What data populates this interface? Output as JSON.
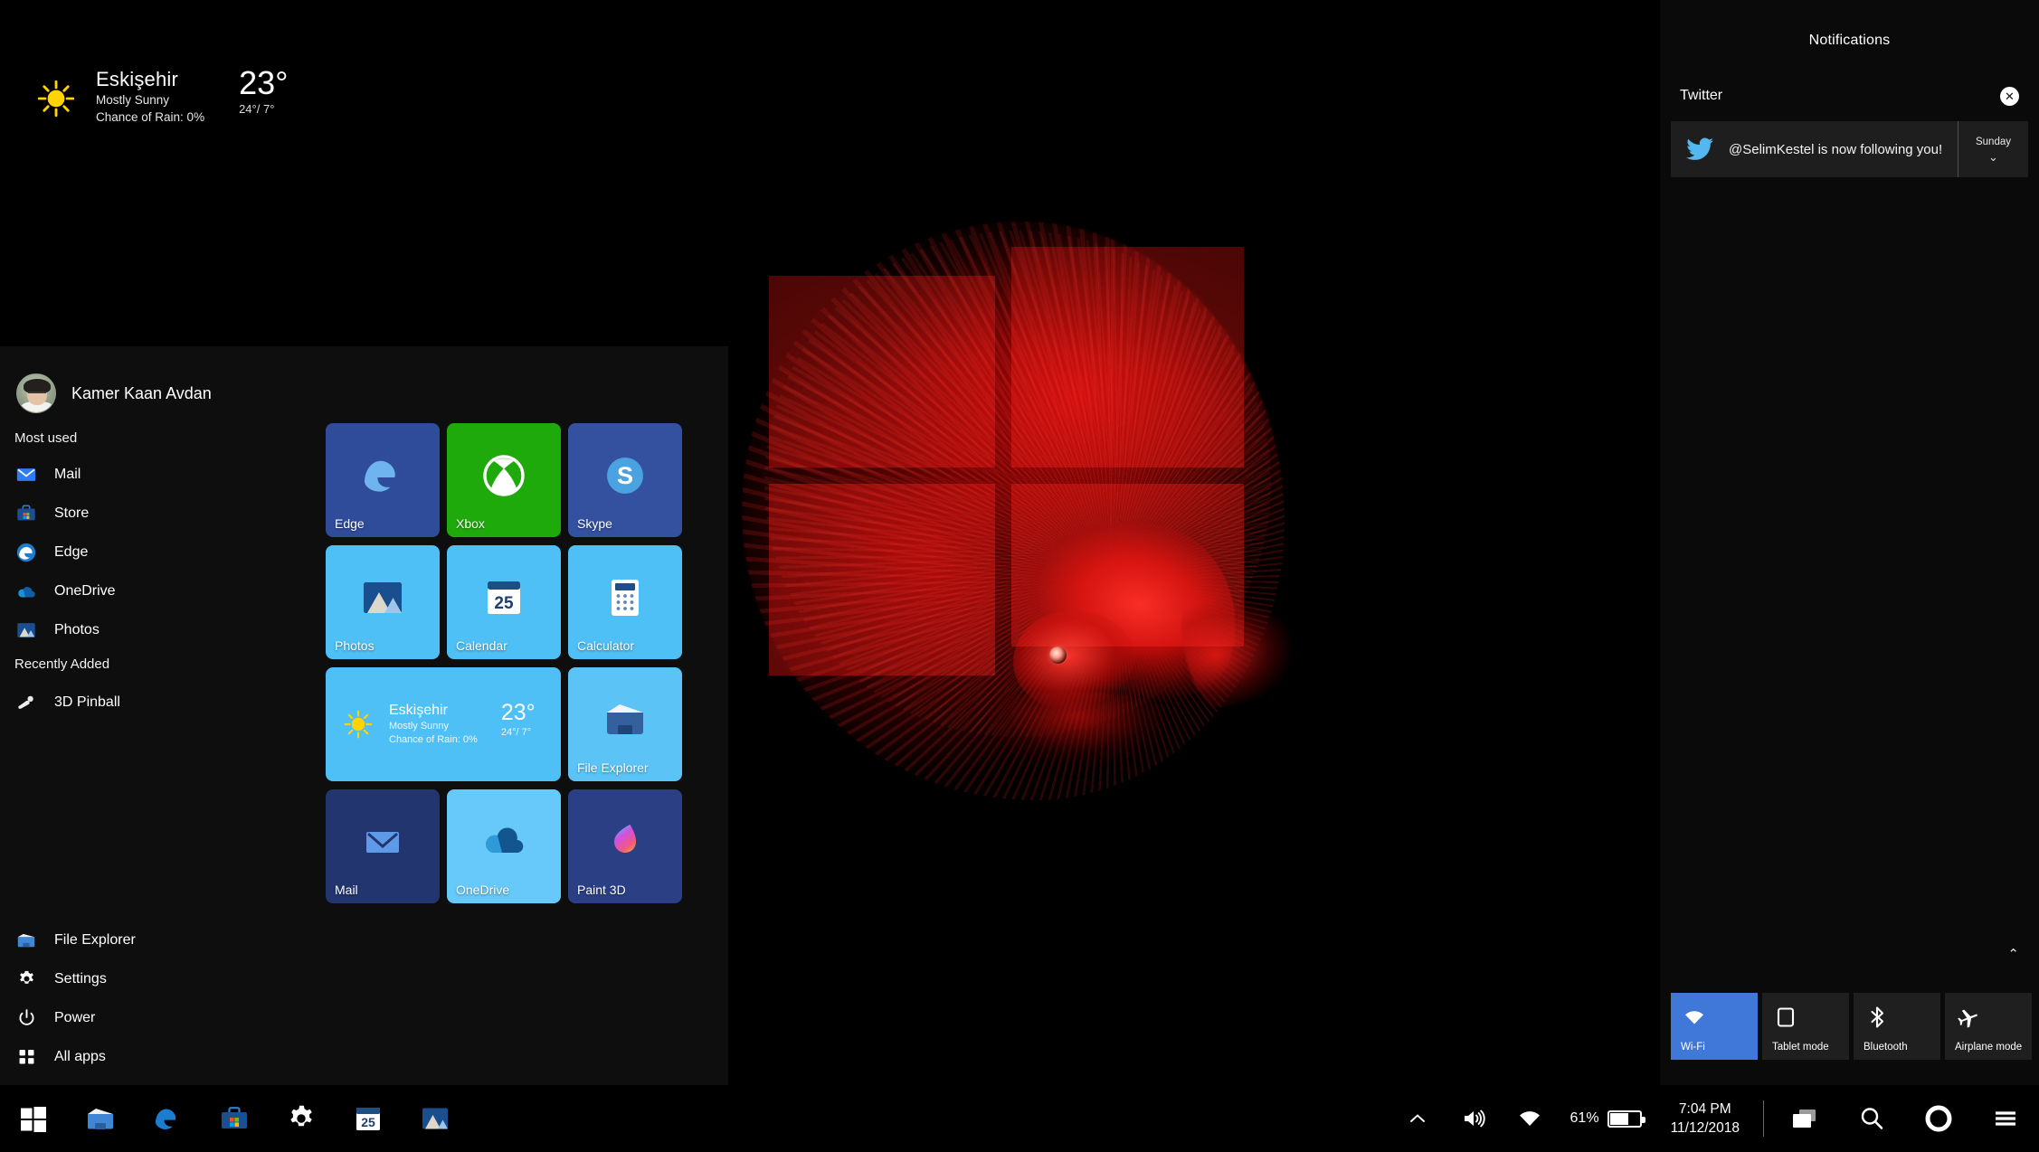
{
  "desktop": {
    "weather_widget": {
      "icon": "sun-icon",
      "city": "Eskişehir",
      "condition": "Mostly Sunny",
      "rain": "Chance of Rain: 0%",
      "temp": "23°",
      "hilo": "24°/ 7°"
    },
    "wallpaper": {
      "description": "red betta fish with windows logo overlay",
      "accent": "#ff1610",
      "background": "#000000"
    }
  },
  "start_menu": {
    "user": {
      "name": "Kamer Kaan Avdan",
      "avatar": "user-avatar"
    },
    "sections": [
      {
        "title": "Most used",
        "items": [
          {
            "label": "Mail",
            "icon": "mail-icon"
          },
          {
            "label": "Store",
            "icon": "store-icon"
          },
          {
            "label": "Edge",
            "icon": "edge-icon"
          },
          {
            "label": "OneDrive",
            "icon": "onedrive-icon"
          },
          {
            "label": "Photos",
            "icon": "photos-icon"
          }
        ]
      },
      {
        "title": "Recently Added",
        "items": [
          {
            "label": "3D Pinball",
            "icon": "pinball-icon"
          }
        ]
      }
    ],
    "bottom_items": [
      {
        "label": "File Explorer",
        "icon": "folder-icon"
      },
      {
        "label": "Settings",
        "icon": "gear-icon"
      },
      {
        "label": "Power",
        "icon": "power-icon"
      },
      {
        "label": "All apps",
        "icon": "grid-icon"
      }
    ],
    "tiles": [
      [
        {
          "label": "Edge",
          "icon": "edge-icon",
          "color": "#2f4c9b"
        },
        {
          "label": "Xbox",
          "icon": "xbox-icon",
          "color": "#1faa0b"
        },
        {
          "label": "Skype",
          "icon": "skype-icon",
          "color": "#33519e"
        }
      ],
      [
        {
          "label": "Photos",
          "icon": "photos-icon",
          "color": "#4ec0f5"
        },
        {
          "label": "Calendar",
          "icon": "calendar-icon",
          "color": "#4ec0f5"
        },
        {
          "label": "Calculator",
          "icon": "calculator-icon",
          "color": "#4ec0f5"
        }
      ],
      [
        {
          "label": "File Explorer",
          "icon": "folder-icon",
          "color": "#5cc3f7"
        }
      ],
      [
        {
          "label": "Mail",
          "icon": "mail-icon",
          "color": "#23356f"
        },
        {
          "label": "OneDrive",
          "icon": "onedrive-icon",
          "color": "#66c9f9"
        },
        {
          "label": "Paint 3D",
          "icon": "paint3d-icon",
          "color": "#2b3f85"
        }
      ]
    ],
    "weather_tile": {
      "icon": "sun-icon",
      "city": "Eskişehir",
      "condition": "Mostly Sunny",
      "rain": "Chance of Rain: 0%",
      "temp": "23°",
      "hilo": "24°/ 7°",
      "color": "#4ec0f5"
    }
  },
  "action_center": {
    "title": "Notifications",
    "app_group": {
      "name": "Twitter",
      "close": "✕"
    },
    "notification": {
      "icon": "twitter-icon",
      "text": "@SelimKestel is now following you!",
      "day": "Sunday",
      "chevron": "⌄"
    },
    "expand_chevron": "⌃",
    "quick_actions": [
      {
        "label": "Wi-Fi",
        "icon": "wifi-icon",
        "active": true
      },
      {
        "label": "Tablet mode",
        "icon": "tablet-icon",
        "active": false
      },
      {
        "label": "Bluetooth",
        "icon": "bluetooth-icon",
        "active": false
      },
      {
        "label": "Airplane mode",
        "icon": "airplane-icon",
        "active": false
      }
    ]
  },
  "taskbar": {
    "left_buttons": [
      {
        "name": "start",
        "icon": "windows-icon"
      },
      {
        "name": "file-explorer",
        "icon": "folder-icon"
      },
      {
        "name": "edge",
        "icon": "edge-icon"
      },
      {
        "name": "store",
        "icon": "store-icon"
      },
      {
        "name": "settings",
        "icon": "gear-icon"
      },
      {
        "name": "calendar",
        "icon": "calendar-icon"
      },
      {
        "name": "photos",
        "icon": "photos-icon"
      }
    ],
    "tray": {
      "show_hidden": "⌃",
      "volume_icon": "speaker-icon",
      "network_icon": "wifi-icon",
      "battery_percent": "61%",
      "battery_level": 61
    },
    "clock": {
      "time": "7:04 PM",
      "date": "11/12/2018"
    },
    "right_buttons": [
      {
        "name": "task-view",
        "icon": "task-view-icon"
      },
      {
        "name": "search",
        "icon": "search-icon"
      },
      {
        "name": "cortana",
        "icon": "cortana-icon"
      },
      {
        "name": "action-center",
        "icon": "hamburger-icon"
      }
    ]
  }
}
